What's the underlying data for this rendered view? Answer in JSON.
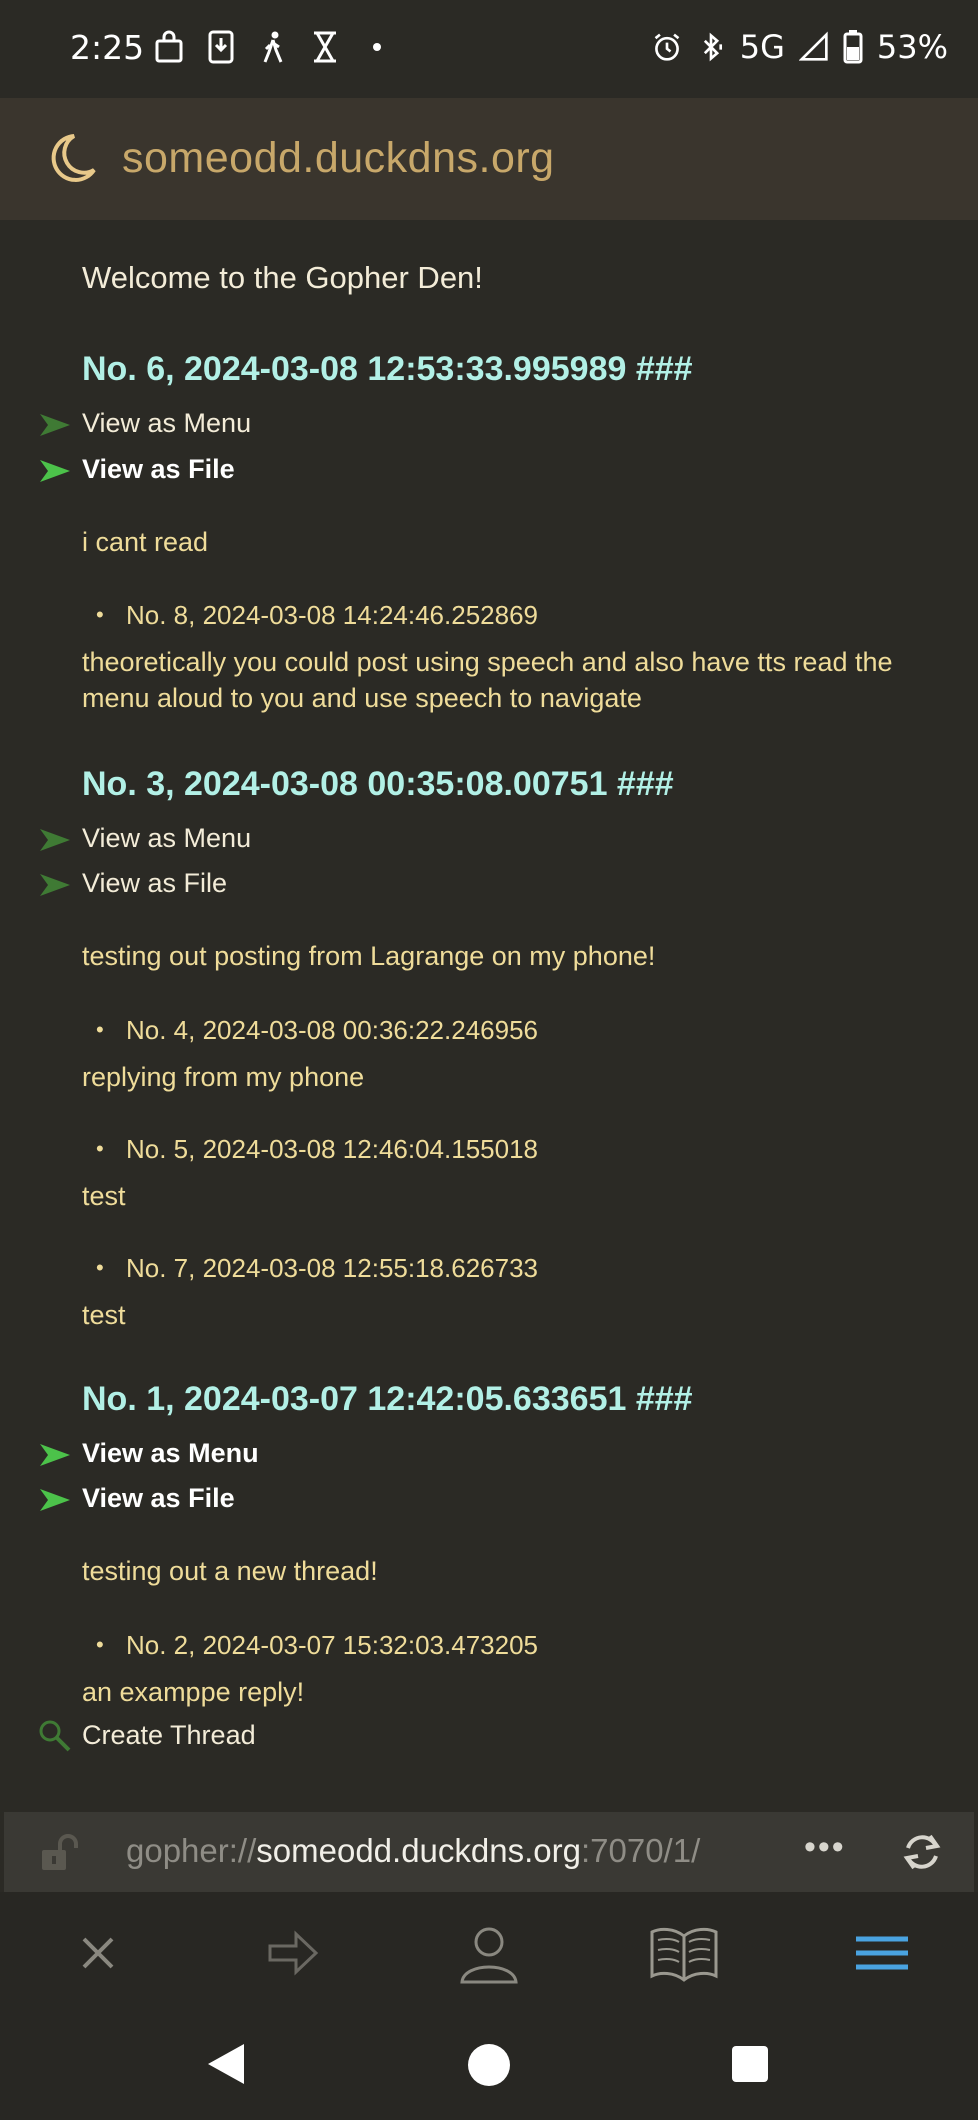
{
  "status_bar": {
    "time": "2:25",
    "network": "5G",
    "battery": "53%"
  },
  "header": {
    "site_title": "someodd.duckdns.org"
  },
  "content": {
    "welcome": "Welcome to the Gopher Den!",
    "threads": [
      {
        "heading": "No. 6, 2024-03-08 12:53:33.995989 ###",
        "link_menu": "View as Menu",
        "link_file": "View as File",
        "body": "i cant read",
        "replies": [
          {
            "meta": "No. 8, 2024-03-08 14:24:46.252869",
            "text": "theoretically you could post using speech and also have tts read the menu aloud to you and use speech to navigate"
          }
        ]
      },
      {
        "heading": "No. 3, 2024-03-08 00:35:08.00751 ###",
        "link_menu": "View as Menu",
        "link_file": "View as File",
        "body": "testing out posting from Lagrange on my phone!",
        "replies": [
          {
            "meta": "No. 4, 2024-03-08 00:36:22.246956",
            "text": "replying from my phone"
          },
          {
            "meta": "No. 5, 2024-03-08 12:46:04.155018",
            "text": "test"
          },
          {
            "meta": "No. 7, 2024-03-08 12:55:18.626733",
            "text": "test"
          }
        ]
      },
      {
        "heading": "No. 1, 2024-03-07 12:42:05.633651 ###",
        "link_menu": "View as Menu",
        "link_file": "View as File",
        "body": "testing out a new thread!",
        "replies": [
          {
            "meta": "No. 2, 2024-03-07 15:32:03.473205",
            "text": "an examppe reply!"
          }
        ]
      }
    ],
    "create_thread": "Create Thread"
  },
  "url_bar": {
    "scheme": "gopher://",
    "host": "someodd.duckdns.org",
    "path": ":7070/1/",
    "more": "•••"
  },
  "colors": {
    "background": "#2b2a25",
    "heading": "#b2f0e6",
    "body_text": "#efdc9a",
    "link_arrow_visited": "#3f7a34",
    "link_arrow_active": "#4cc24a",
    "site_title": "#c8a86a",
    "accent_menu": "#4aa3e0"
  },
  "icons": {
    "toolbar": [
      "close-icon",
      "forward-icon",
      "identity-icon",
      "bookmarks-icon",
      "menu-icon"
    ],
    "nav": [
      "back-triangle-icon",
      "home-circle-icon",
      "recents-square-icon"
    ]
  }
}
